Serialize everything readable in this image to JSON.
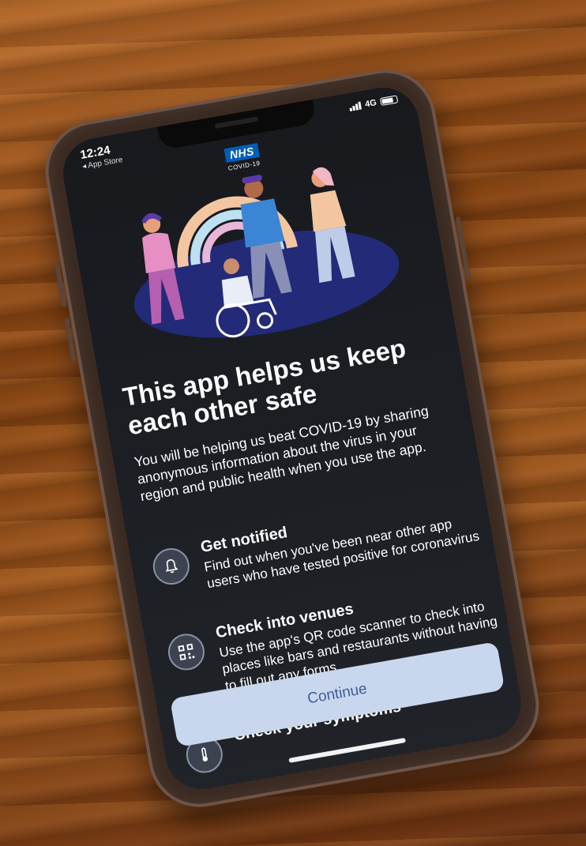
{
  "status_bar": {
    "time": "12:24",
    "back_label": "App Store",
    "network": "4G"
  },
  "logo": {
    "brand": "NHS",
    "subtitle": "COVID-19"
  },
  "onboarding": {
    "title": "This app helps us keep each other safe",
    "intro": "You will be helping us beat COVID-19 by sharing anonymous information about the virus in your region and public health when you use the app.",
    "features": [
      {
        "icon": "bell-icon",
        "title": "Get notified",
        "description": "Find out when you've been near other app users who have tested positive for coronavirus"
      },
      {
        "icon": "qr-code-icon",
        "title": "Check into venues",
        "description": "Use the app's QR code scanner to check into places like bars and restaurants without having to fill out any forms."
      },
      {
        "icon": "thermometer-icon",
        "title": "Check your symptoms",
        "description": ""
      }
    ],
    "continue_label": "Continue"
  },
  "colors": {
    "nhs_blue": "#005eb8",
    "button_bg": "#c9d7ee",
    "button_text": "#3b5d97",
    "screen_bg": "#1c1f24"
  }
}
